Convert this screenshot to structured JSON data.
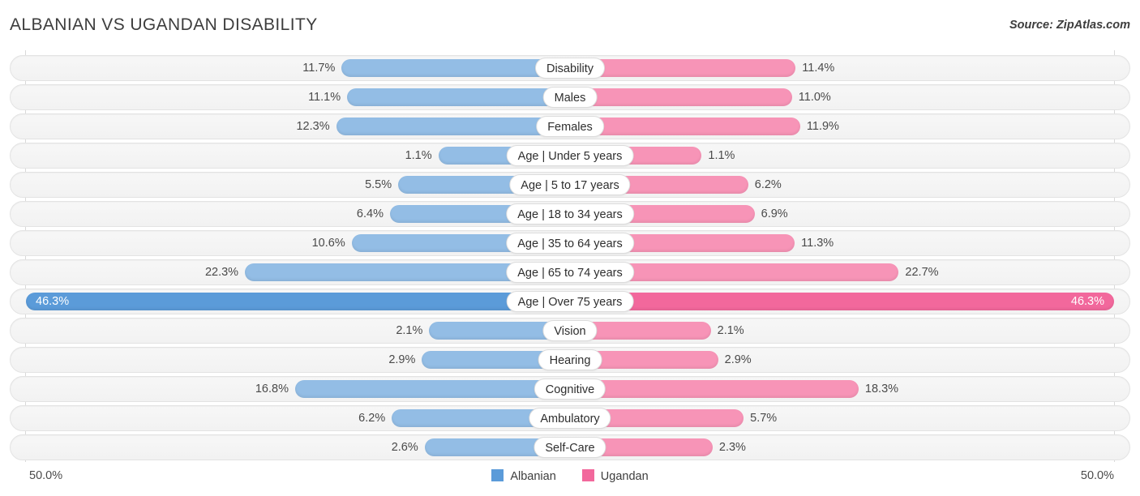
{
  "header": {
    "title": "ALBANIAN VS UGANDAN DISABILITY",
    "source": "Source: ZipAtlas.com"
  },
  "axis": {
    "left_label": "50.0%",
    "right_label": "50.0%"
  },
  "legend": [
    {
      "label": "Albanian",
      "color": "#5b9bd9"
    },
    {
      "label": "Ugandan",
      "color": "#f2689c"
    }
  ],
  "colors": {
    "albanian_bar": "#93bde5",
    "ugandan_bar": "#f794b7",
    "albanian_bar_max": "#5b9bd9",
    "ugandan_bar_max": "#f2689c",
    "track": "#f5f5f5",
    "gridline": "#d9d9d9"
  },
  "chart_data": {
    "type": "bar",
    "title": "ALBANIAN VS UGANDAN DISABILITY",
    "subtitle": "Source: ZipAtlas.com",
    "orientation": "horizontal-diverging",
    "xlabel": "",
    "ylabel": "",
    "xlim": [
      -50.0,
      50.0
    ],
    "axis_tick_labels": [
      "50.0%",
      "50.0%"
    ],
    "grid": true,
    "legend_position": "bottom-center",
    "categories": [
      "Disability",
      "Males",
      "Females",
      "Age | Under 5 years",
      "Age | 5 to 17 years",
      "Age | 18 to 34 years",
      "Age | 35 to 64 years",
      "Age | 65 to 74 years",
      "Age | Over 75 years",
      "Vision",
      "Hearing",
      "Cognitive",
      "Ambulatory",
      "Self-Care"
    ],
    "series": [
      {
        "name": "Albanian",
        "color": "#5b9bd9",
        "values": [
          11.7,
          11.1,
          12.3,
          1.1,
          5.5,
          6.4,
          10.6,
          22.3,
          46.3,
          2.1,
          2.9,
          16.8,
          6.2,
          2.6
        ],
        "value_labels": [
          "11.7%",
          "11.1%",
          "12.3%",
          "1.1%",
          "5.5%",
          "6.4%",
          "10.6%",
          "22.3%",
          "46.3%",
          "2.1%",
          "2.9%",
          "16.8%",
          "6.2%",
          "2.6%"
        ]
      },
      {
        "name": "Ugandan",
        "color": "#f2689c",
        "values": [
          11.4,
          11.0,
          11.9,
          1.1,
          6.2,
          6.9,
          11.3,
          22.7,
          46.3,
          2.1,
          2.9,
          18.3,
          5.7,
          2.3
        ],
        "value_labels": [
          "11.4%",
          "11.0%",
          "11.9%",
          "1.1%",
          "6.2%",
          "6.9%",
          "11.3%",
          "22.7%",
          "46.3%",
          "2.1%",
          "2.9%",
          "18.3%",
          "5.7%",
          "2.3%"
        ]
      }
    ],
    "rows": [
      {
        "category": "Disability",
        "left_value": 11.7,
        "right_value": 11.4,
        "left_label": "11.7%",
        "right_label": "11.4%",
        "highlight": false
      },
      {
        "category": "Males",
        "left_value": 11.1,
        "right_value": 11.0,
        "left_label": "11.1%",
        "right_label": "11.0%",
        "highlight": false
      },
      {
        "category": "Females",
        "left_value": 12.3,
        "right_value": 11.9,
        "left_label": "12.3%",
        "right_label": "11.9%",
        "highlight": false
      },
      {
        "category": "Age | Under 5 years",
        "left_value": 1.1,
        "right_value": 1.1,
        "left_label": "1.1%",
        "right_label": "1.1%",
        "highlight": false
      },
      {
        "category": "Age | 5 to 17 years",
        "left_value": 5.5,
        "right_value": 6.2,
        "left_label": "5.5%",
        "right_label": "6.2%",
        "highlight": false
      },
      {
        "category": "Age | 18 to 34 years",
        "left_value": 6.4,
        "right_value": 6.9,
        "left_label": "6.4%",
        "right_label": "6.9%",
        "highlight": false
      },
      {
        "category": "Age | 35 to 64 years",
        "left_value": 10.6,
        "right_value": 11.3,
        "left_label": "10.6%",
        "right_label": "11.3%",
        "highlight": false
      },
      {
        "category": "Age | 65 to 74 years",
        "left_value": 22.3,
        "right_value": 22.7,
        "left_label": "22.3%",
        "right_label": "22.7%",
        "highlight": false
      },
      {
        "category": "Age | Over 75 years",
        "left_value": 46.3,
        "right_value": 46.3,
        "left_label": "46.3%",
        "right_label": "46.3%",
        "highlight": true
      },
      {
        "category": "Vision",
        "left_value": 2.1,
        "right_value": 2.1,
        "left_label": "2.1%",
        "right_label": "2.1%",
        "highlight": false
      },
      {
        "category": "Hearing",
        "left_value": 2.9,
        "right_value": 2.9,
        "left_label": "2.9%",
        "right_label": "2.9%",
        "highlight": false
      },
      {
        "category": "Cognitive",
        "left_value": 16.8,
        "right_value": 18.3,
        "left_label": "16.8%",
        "right_label": "18.3%",
        "highlight": false
      },
      {
        "category": "Ambulatory",
        "left_value": 6.2,
        "right_value": 5.7,
        "left_label": "6.2%",
        "right_label": "5.7%",
        "highlight": false
      },
      {
        "category": "Self-Care",
        "left_value": 2.6,
        "right_value": 2.3,
        "left_label": "2.6%",
        "right_label": "2.3%",
        "highlight": false
      }
    ]
  }
}
